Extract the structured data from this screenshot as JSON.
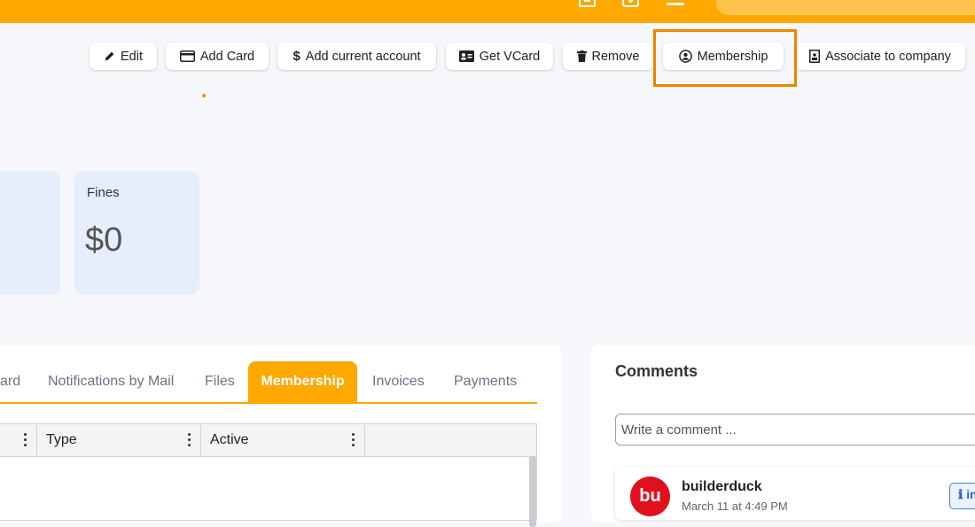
{
  "toolbar": {
    "edit": "Edit",
    "add_card": "Add Card",
    "add_current_account": "Add current account",
    "get_vcard": "Get VCard",
    "remove": "Remove",
    "membership": "Membership",
    "associate_company": "Associate to company"
  },
  "stats": {
    "fines_label": "Fines",
    "fines_value": "$0"
  },
  "tabs": {
    "items": [
      {
        "label": "ard"
      },
      {
        "label": "Notifications by Mail"
      },
      {
        "label": "Files"
      },
      {
        "label": "Membership"
      },
      {
        "label": "Invoices"
      },
      {
        "label": "Payments"
      }
    ],
    "active": "Membership"
  },
  "grid": {
    "columns": [
      "Type",
      "Active"
    ]
  },
  "comments": {
    "title": "Comments",
    "placeholder": "Write a comment ...",
    "entries": [
      {
        "avatar": "bu",
        "user": "builderduck",
        "date": "March 11 at 4:49 PM",
        "badge": "in"
      }
    ]
  },
  "colors": {
    "brand": "#ffa800",
    "highlight": "#f08200",
    "avatar": "#e0101e",
    "card": "#e6edfb"
  }
}
